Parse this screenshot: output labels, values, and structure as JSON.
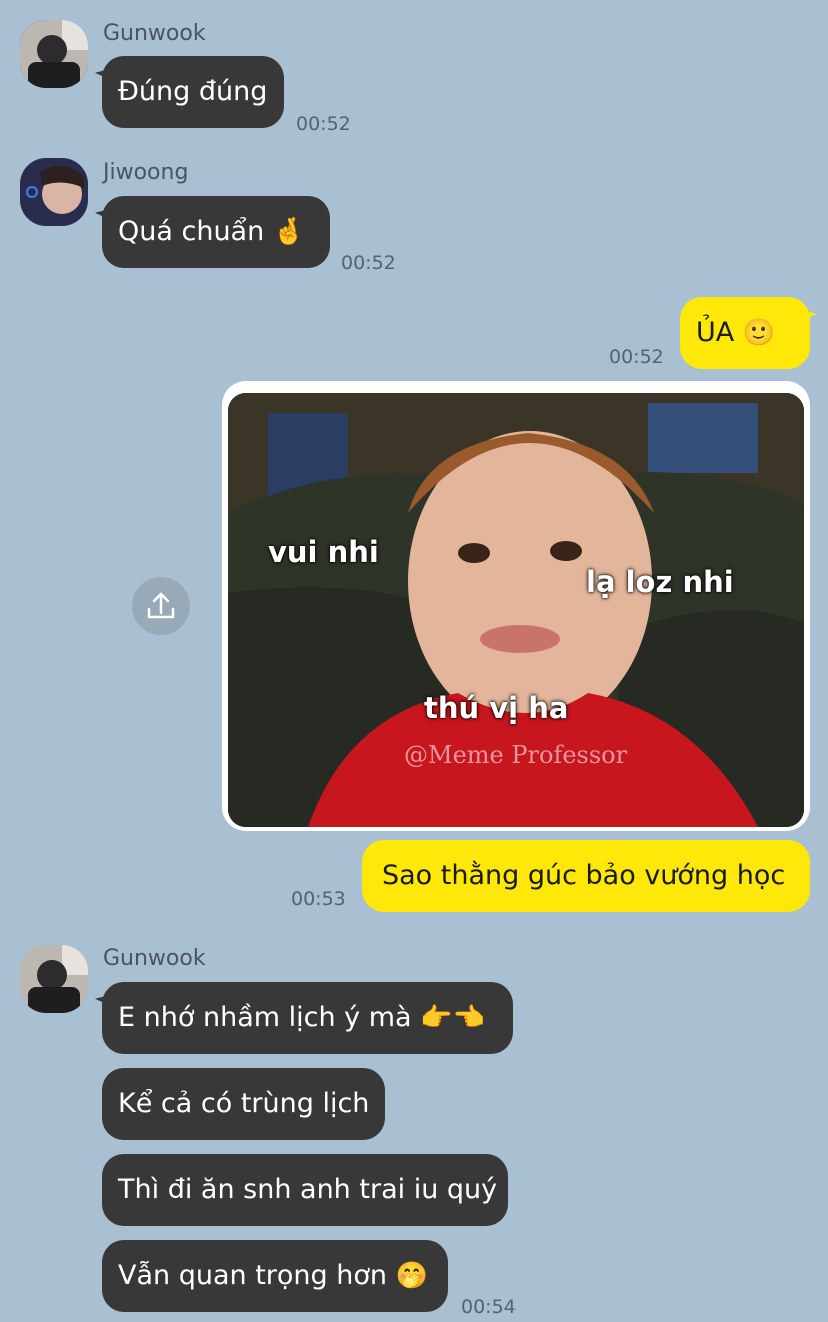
{
  "messages": {
    "g1": {
      "sender": "Gunwook",
      "text": "Đúng đúng",
      "time": "00:52"
    },
    "j1": {
      "sender": "Jiwoong",
      "text": "Quá chuẩn",
      "emoji": "🤞",
      "time": "00:52"
    },
    "me1": {
      "text": "ỦA",
      "emoji": "🙂",
      "time": "00:52"
    },
    "img": {
      "captions": {
        "left": "vui nhi",
        "right": "lạ loz nhi",
        "bottom": "thú vị ha"
      },
      "watermark": "@Meme Professor"
    },
    "me2": {
      "text": "Sao thằng gúc bảo vướng học",
      "time": "00:53"
    },
    "g2": {
      "sender": "Gunwook",
      "items": [
        {
          "text": "E nhớ nhầm lịch ý mà",
          "emoji": "👉👈"
        },
        {
          "text": "Kể cả có trùng lịch"
        },
        {
          "text": "Thì đi ăn snh anh trai iu quý"
        },
        {
          "text": "Vẫn quan trọng hơn",
          "emoji": "🤭"
        }
      ],
      "time": "00:54"
    }
  },
  "colors": {
    "background": "#a9c0d2",
    "incoming": "#383838",
    "outgoing": "#fde80a"
  },
  "icons": [
    "share-icon"
  ]
}
